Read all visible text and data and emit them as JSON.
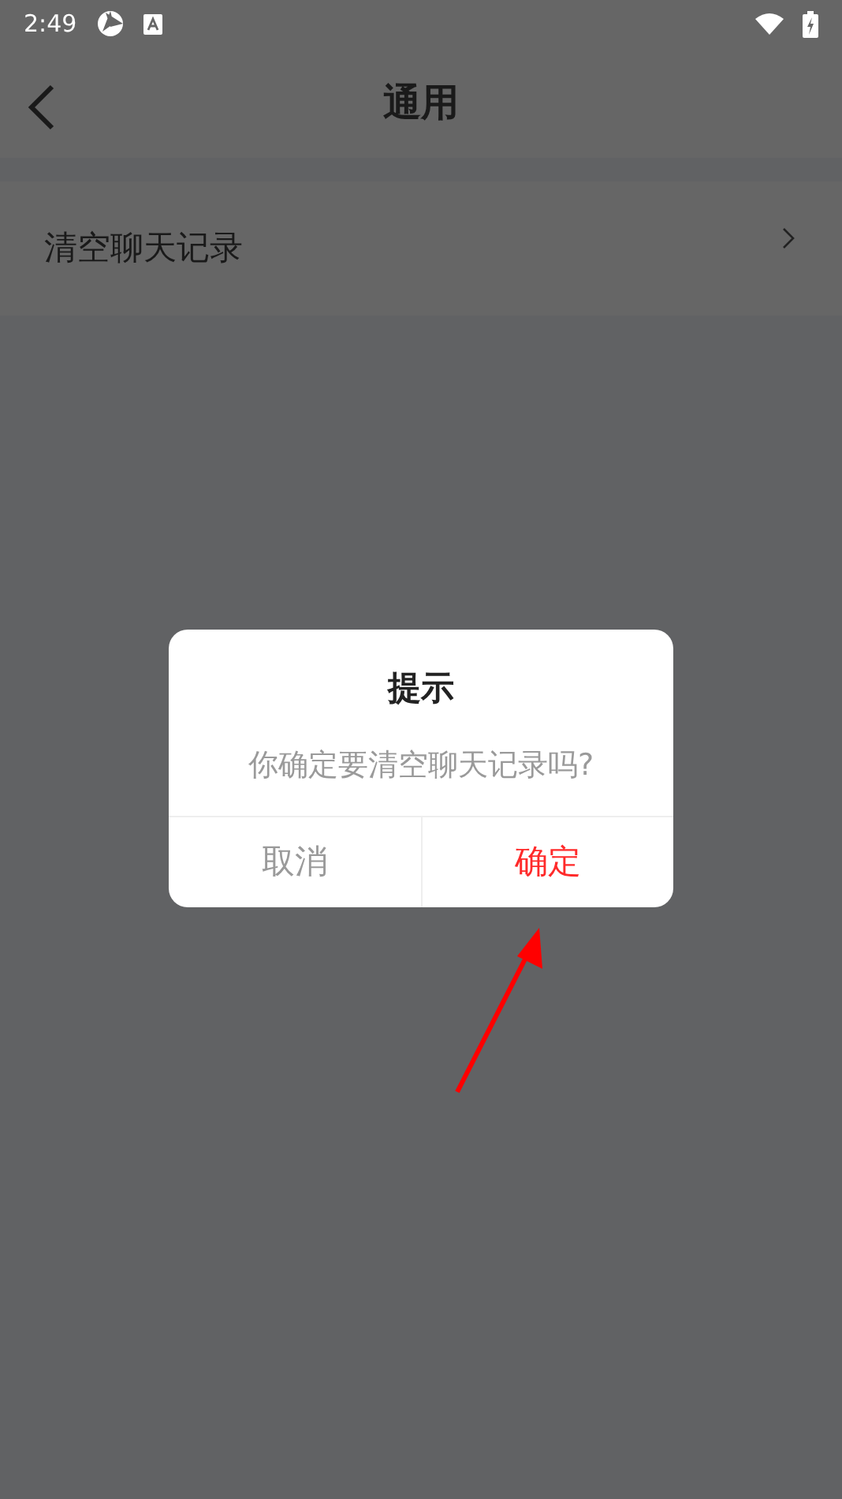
{
  "status_bar": {
    "time": "2:49"
  },
  "header": {
    "title": "通用"
  },
  "settings_items": [
    {
      "label": "清空聊天记录"
    }
  ],
  "dialog": {
    "title": "提示",
    "message": "你确定要清空聊天记录吗?",
    "buttons": [
      {
        "label": "取消",
        "kind": "cancel"
      },
      {
        "label": "确定",
        "kind": "confirm"
      }
    ]
  }
}
